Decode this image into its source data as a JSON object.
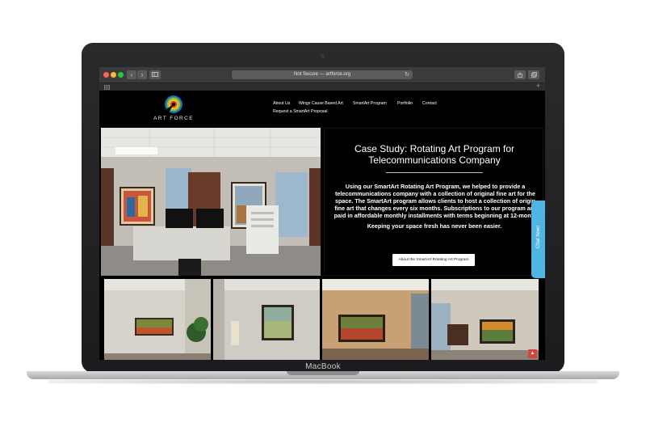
{
  "device": {
    "label": "MacBook"
  },
  "browser": {
    "address": "Not Secure — artforce.org",
    "back_icon": "chevron-left-icon",
    "forward_icon": "chevron-right-icon",
    "sidebar_icon": "sidebar-icon",
    "reload_icon": "reload-icon",
    "share_icon": "share-icon",
    "tabs_icon": "tabs-icon",
    "new_tab_label": "+",
    "grid_icon": "grid-icon"
  },
  "site": {
    "logo_text": "ART FORCE",
    "nav": {
      "about": "About Us",
      "wings": "Wings Cause Based Art",
      "smartart": "SmartArt Program",
      "portfolio": "Portfolio",
      "contact": "Contact",
      "proposal": "Request a SmartArt Proposal"
    },
    "case_study": {
      "title_line1": "Case Study: Rotating Art Program for",
      "title_line2": "Telecommunications Company",
      "body_lines": [
        "Using our SmartArt Rotating Art Program, we helped to provide a",
        "telecommunications company with a  collection of original fine art for the",
        "space. The SmartArt program allows clients to host a collection of origin",
        "fine art that changes every six months. Subscriptions to our program are",
        "paid in affordable monthly installments with terms beginning at 12-month"
      ],
      "tagline": "Keeping your space fresh has never been easier.",
      "button": "About the SmartArt Rotating Art Program"
    },
    "chat": "Chat Now!",
    "back_to_top_icon": "arrow-up-icon"
  },
  "colors": {
    "accent": "#4fb6e3",
    "to_top": "#d6453a"
  }
}
